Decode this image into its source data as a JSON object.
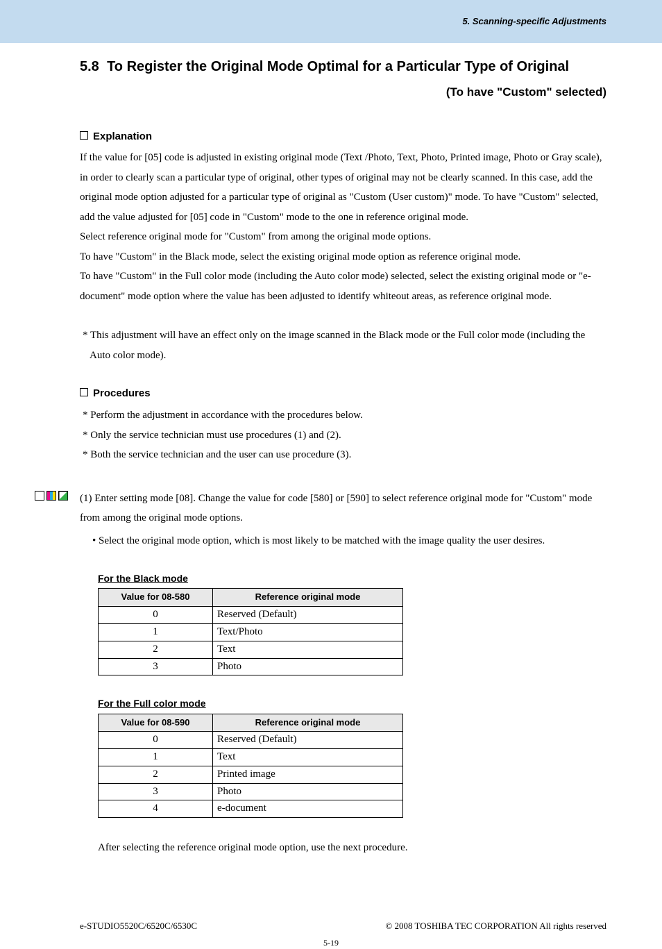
{
  "header": {
    "breadcrumb": "5. Scanning-specific Adjustments"
  },
  "title": {
    "number": "5.8",
    "text": "To Register the Original Mode Optimal for a Particular Type of Original",
    "subtitle": "(To have \"Custom\" selected)"
  },
  "explanation": {
    "heading": "Explanation",
    "para1": "If the value for [05] code is adjusted in existing original mode (Text /Photo, Text, Photo, Printed image, Photo or Gray scale), in order to clearly scan a particular type of original, other types of original may not be clearly scanned.  In this case, add the original mode option adjusted for a particular type of original as \"Custom (User custom)\" mode.  To have \"Custom\" selected, add the value adjusted for [05] code in \"Custom\" mode to the one in reference original mode.",
    "para2": "Select reference original mode for \"Custom\" from among the original mode options.",
    "para3": "To have \"Custom\" in the Black mode, select the existing original mode option as reference original mode.",
    "para4": "To have \"Custom\" in the Full color mode (including the Auto color mode) selected, select the existing original mode or \"e-document\" mode option where the value has been adjusted to identify whiteout areas, as reference original mode.",
    "note": "* This adjustment will have an effect only on the image scanned in the Black mode or the Full color mode (including the Auto color mode)."
  },
  "procedures": {
    "heading": "Procedures",
    "lines": [
      "* Perform the adjustment in accordance with the procedures below.",
      "* Only the service technician must use procedures (1) and (2).",
      "* Both the service technician and the user can use procedure (3)."
    ],
    "step1": {
      "text": "(1)  Enter setting mode [08].  Change the value for code [580] or [590] to select reference original mode for \"Custom\" mode from among the original mode options.",
      "bullet": "• Select the original mode option, which is most likely to be matched with the image quality the user desires."
    }
  },
  "table_black": {
    "title": "For the Black mode",
    "head_val": "Value for 08-580",
    "head_mode": "Reference original mode",
    "rows": [
      {
        "val": "0",
        "mode": "Reserved (Default)"
      },
      {
        "val": "1",
        "mode": "Text/Photo"
      },
      {
        "val": "2",
        "mode": "Text"
      },
      {
        "val": "3",
        "mode": "Photo"
      }
    ]
  },
  "table_color": {
    "title": "For the Full color mode",
    "head_val": "Value for 08-590",
    "head_mode": "Reference original mode",
    "rows": [
      {
        "val": "0",
        "mode": "Reserved (Default)"
      },
      {
        "val": "1",
        "mode": "Text"
      },
      {
        "val": "2",
        "mode": "Printed image"
      },
      {
        "val": "3",
        "mode": "Photo"
      },
      {
        "val": "4",
        "mode": "e-document"
      }
    ]
  },
  "after_note": "After selecting the reference original mode option, use the next procedure.",
  "footer": {
    "left": "e-STUDIO5520C/6520C/6530C",
    "right": "© 2008 TOSHIBA TEC CORPORATION All rights reserved",
    "pagenum": "5-19"
  }
}
